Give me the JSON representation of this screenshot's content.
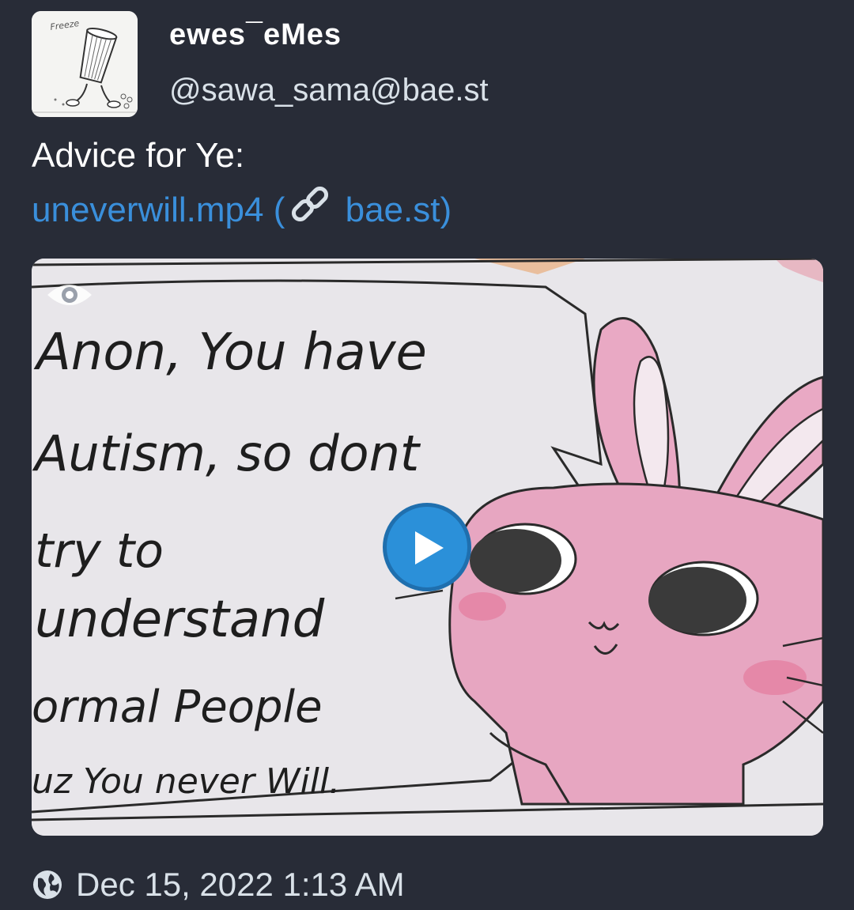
{
  "author": {
    "display_name": "ewes¯eMes",
    "handle": "@sawa_sama@bae.st",
    "avatar_caption": "Freeze"
  },
  "status": {
    "text": "Advice for Ye:",
    "attachment_name": "uneverwill.mp4",
    "attachment_host": "bae.st"
  },
  "media": {
    "type": "video",
    "drawing_text": [
      "Anon, You have",
      "Autism, so dont",
      "try to",
      "understand",
      "ormal People",
      "uz You never Will."
    ],
    "play_icon": "play-icon",
    "visibility_icon": "eye-icon"
  },
  "footer": {
    "visibility_icon": "globe-icon",
    "timestamp": "Dec 15, 2022 1:13 AM"
  },
  "colors": {
    "background": "#282c37",
    "link": "#3a8fdb",
    "play_button": "#2b90d9",
    "muted_text": "#d9e1e8"
  }
}
